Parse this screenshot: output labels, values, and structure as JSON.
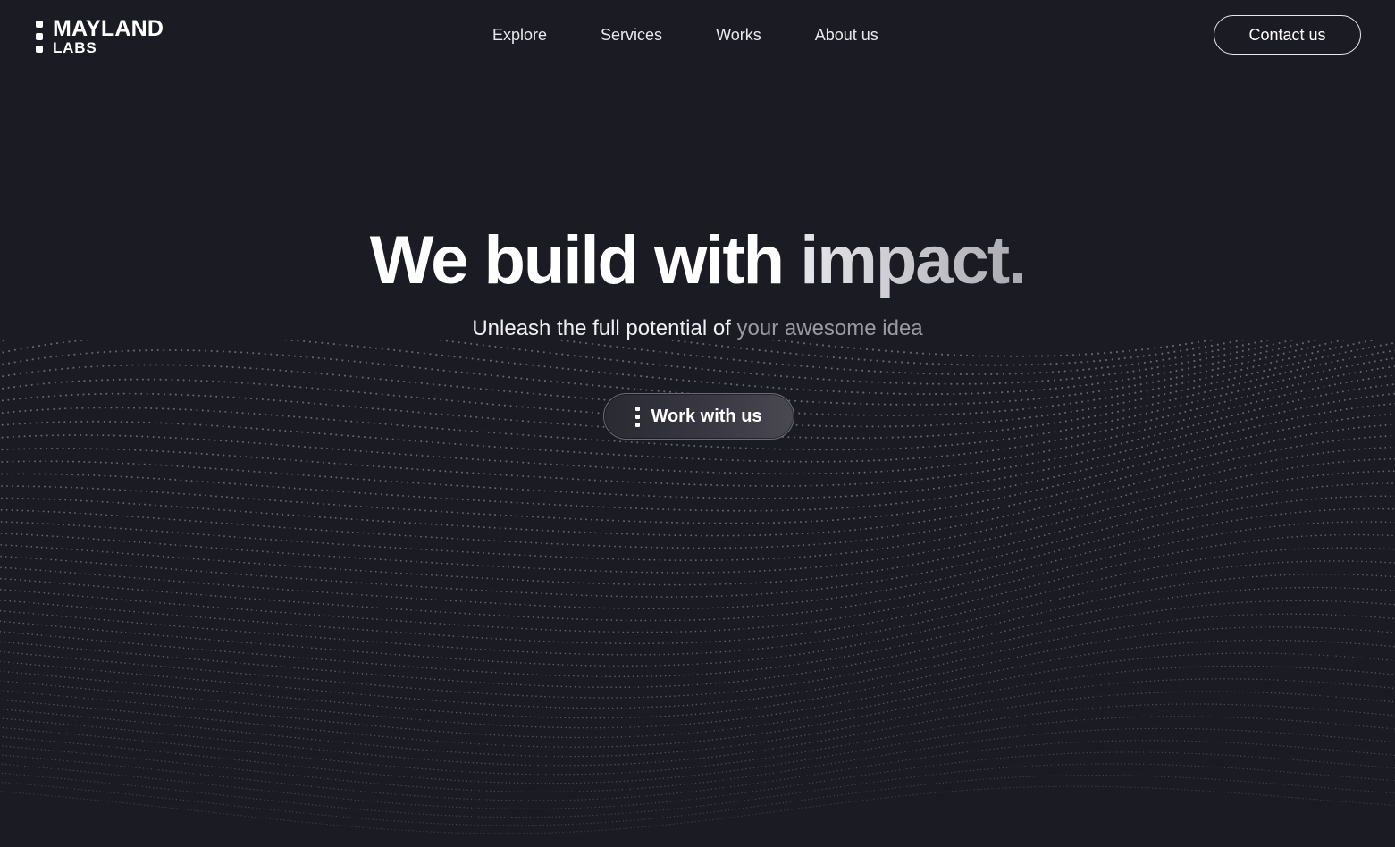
{
  "brand": {
    "line1": "MAYLAND",
    "line2": "LABS"
  },
  "nav": {
    "items": [
      {
        "label": "Explore"
      },
      {
        "label": "Services"
      },
      {
        "label": "Works"
      },
      {
        "label": "About us"
      }
    ]
  },
  "header": {
    "contact_label": "Contact us"
  },
  "hero": {
    "title_part1": "We build with",
    "title_part2": "impact.",
    "subtitle_part1": "Unleash the full potential of",
    "subtitle_part2": "your awesome idea",
    "cta_label": "Work with us"
  },
  "colors": {
    "background": "#1b1b23",
    "text": "#ffffff",
    "muted_text": "#9a9aa4",
    "particle": "#c8c8d0"
  }
}
